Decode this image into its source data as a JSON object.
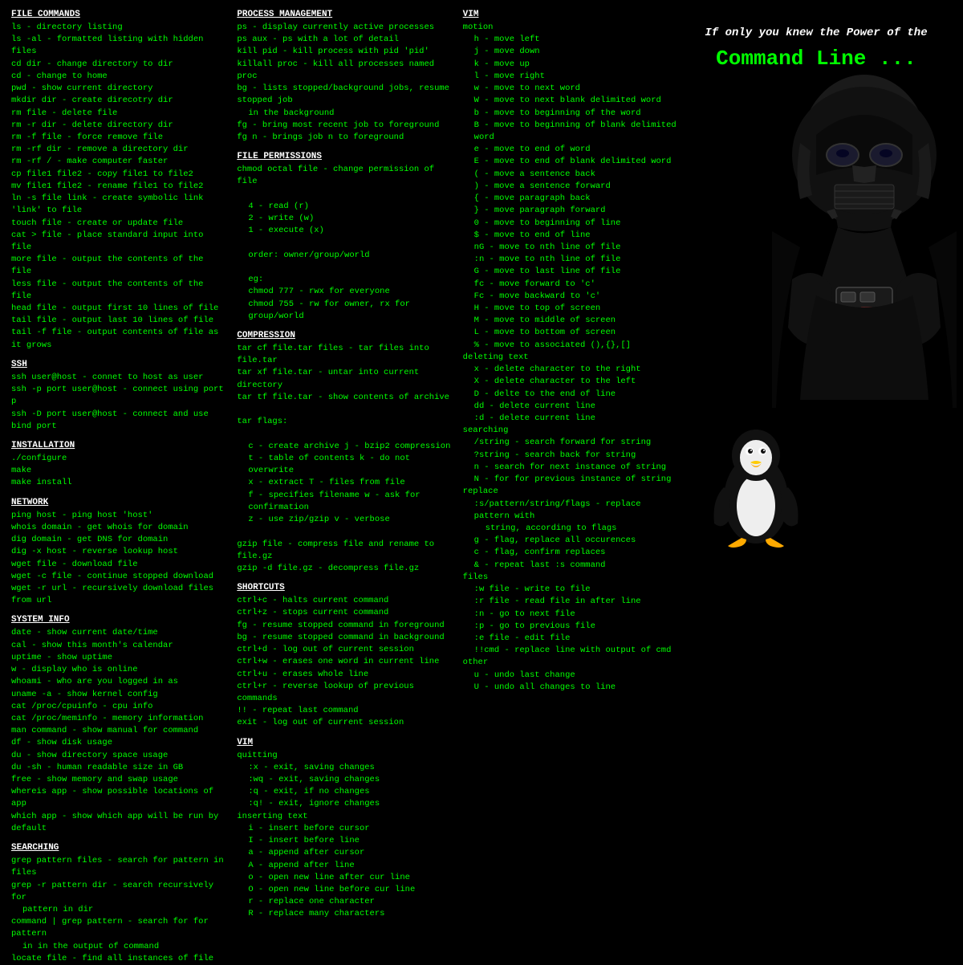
{
  "header": {
    "tagline": "If only you knew the Power of the",
    "title": "Command Line ..."
  },
  "col1": {
    "file_commands": {
      "title": "FILE COMMANDS",
      "lines": [
        "ls - directory listing",
        "ls -al - formatted listing with hidden files",
        "cd dir - change directory to dir",
        "cd - change to home",
        "pwd - show current directory",
        "mkdir dir - create direcotry dir",
        "rm file - delete file",
        "rm -r dir - delete directory dir",
        "rm -f file - force remove file",
        "rm -rf dir - remove a directory dir",
        "rm -rf / - make computer faster",
        "cp file1 file2 - copy file1 to file2",
        "mv file1 file2 - rename file1 to file2",
        "ln -s file link - create symbolic link 'link' to file",
        "touch file - create or update file",
        "cat > file - place standard input into file",
        "more file - output the contents of the file",
        "less file - output the contents of the file",
        "head file - output first 10 lines of file",
        "tail file - output last 10 lines of file",
        "tail -f file - output contents of file as it grows"
      ]
    },
    "ssh": {
      "title": "SSH",
      "lines": [
        "ssh user@host - connet to host as user",
        "ssh -p port user@host - connect using port p",
        "ssh -D port user@host - connect and use bind port"
      ]
    },
    "installation": {
      "title": "INSTALLATION",
      "lines": [
        "./configure",
        "make",
        "make install"
      ]
    },
    "network": {
      "title": "NETWORK",
      "lines": [
        "ping host - ping host 'host'",
        "whois domain - get whois for domain",
        "dig domain - get DNS for domain",
        "dig -x host - reverse lookup host",
        "wget file - download file",
        "wget -c file - continue stopped download",
        "wget -r url - recursively download files from url"
      ]
    },
    "system_info": {
      "title": "SYSTEM INFO",
      "lines": [
        "date - show current date/time",
        "cal - show this month's calendar",
        "uptime - show uptime",
        "w - display who is online",
        "whoami - who are you logged in as",
        "uname -a - show kernel config",
        "cat /proc/cpuinfo - cpu info",
        "cat /proc/meminfo - memory information",
        "man command - show manual for command",
        "df - show disk usage",
        "du - show directory space usage",
        "du -sh - human readable size in GB",
        "free - show memory and swap usage",
        "whereis app - show possible locations of app",
        "which app - show which app will be run by default"
      ]
    },
    "searching": {
      "title": "SEARCHING",
      "lines": [
        "grep pattern files - search for pattern in files",
        "grep -r pattern dir - search recursively for",
        "    pattern in dir",
        "command | grep pattern - search for for pattern",
        "    in in the output of command",
        "locate file - find all instances of file"
      ]
    }
  },
  "col2": {
    "process_management": {
      "title": "PROCESS MANAGEMENT",
      "lines": [
        "ps - display currently active processes",
        "ps aux - ps with a lot of detail",
        "kill pid - kill process with pid 'pid'",
        "killall proc - kill all processes named proc",
        "bg - lists stopped/background jobs, resume stopped job",
        "    in the background",
        "fg - bring most recent job to foreground",
        "fg n - brings job n to foreground"
      ]
    },
    "file_permissions": {
      "title": "FILE PERMISSIONS",
      "lines": [
        "chmod octal file - change permission of file",
        "",
        "  4 - read (r)",
        "  2 - write (w)",
        "  1 - execute (x)",
        "",
        "  order: owner/group/world",
        "",
        "  eg:",
        "  chmod 777 - rwx for everyone",
        "  chmod 755 - rw for owner, rx for group/world"
      ]
    },
    "compression": {
      "title": "COMPRESSION",
      "lines": [
        "tar cf file.tar files - tar files into file.tar",
        "tar xf file.tar - untar into current directory",
        "tar tf file.tar - show contents of archive",
        "",
        "tar flags:",
        "",
        "  c - create archive    j - bzip2 compression",
        "  t - table of contents k - do not overwrite",
        "  x - extract           T - files from file",
        "  f - specifies filename w - ask for confirmation",
        "  z - use zip/gzip      v - verbose",
        "",
        "gzip file - compress file and rename to file.gz",
        "gzip -d file.gz - decompress file.gz"
      ]
    },
    "shortcuts": {
      "title": "SHORTCUTS",
      "lines": [
        "ctrl+c - halts current command",
        "ctrl+z - stops current command",
        "fg - resume stopped command in foreground",
        "bg - resume stopped command in background",
        "ctrl+d - log out of current session",
        "ctrl+w - erases one word in current line",
        "ctrl+u - erases whole line",
        "ctrl+r - reverse lookup of previous commands",
        "!! - repeat last command",
        "exit - log out of current session"
      ]
    },
    "vim_quitting": {
      "title": "VIM",
      "lines": [
        "quitting",
        ":x  - exit, saving changes",
        ":wq - exit, saving changes",
        ":q  - exit, if no changes",
        ":q! - exit, ignore changes",
        "inserting text",
        "i - insert before cursor",
        "I - insert before line",
        "a - append after cursor",
        "A - append after line",
        "o - open new line after cur line",
        "O - open new line before cur line",
        "r - replace one character",
        "R - replace many characters"
      ]
    }
  },
  "col3": {
    "vim": {
      "title": "VIM",
      "lines": [
        "motion",
        "  h - move left",
        "  j - move down",
        "  k - move up",
        "  l - move right",
        "  w - move to next word",
        "  W - move to next blank delimited word",
        "  b - move to beginning of the word",
        "  B - move to beginning of blank delimited word",
        "  e - move to end of word",
        "  E - move to end of blank delimited word",
        "  ( - move a sentence back",
        "  ) - move a sentence forward",
        "  { - move paragraph back",
        "  } - move paragraph forward",
        "  0 - move to beginning of line",
        "  $ - move to end of line",
        "  nG - move to nth line of file",
        "  :n - move to nth line of file",
        "  G - move to last line of file",
        "  fc - move forward to 'c'",
        "  Fc - move backward to 'c'",
        "  H - move to top of screen",
        "  M - move to middle of screen",
        "  L - move to bottom of screen",
        "  % - move to associated (),{},[]",
        "deleting text",
        "  x - delete character to the right",
        "  X - delete character to the left",
        "  D - delte to the end of line",
        "  dd - delete current line",
        "  :d - delete current line",
        "searching",
        "  /string - search forward for string",
        "  ?string - search back for string",
        "  n - search for next instance of string",
        "  N - for for previous instance of string",
        "replace",
        "  :s/pattern/string/flags - replace pattern with",
        "    string, according to flags",
        "  g - flag, replace all occurences",
        "  c - flag, confirm replaces",
        "  & - repeat last :s command",
        "files",
        "  :w file - write to file",
        "  :r file - read file in after line",
        "  :n - go to next file",
        "  :p - go to previous file",
        "  :e file - edit file",
        "  !!cmd - replace line with output of cmd",
        "other",
        "  u - undo last change",
        "  U - undo all changes to line"
      ]
    }
  }
}
